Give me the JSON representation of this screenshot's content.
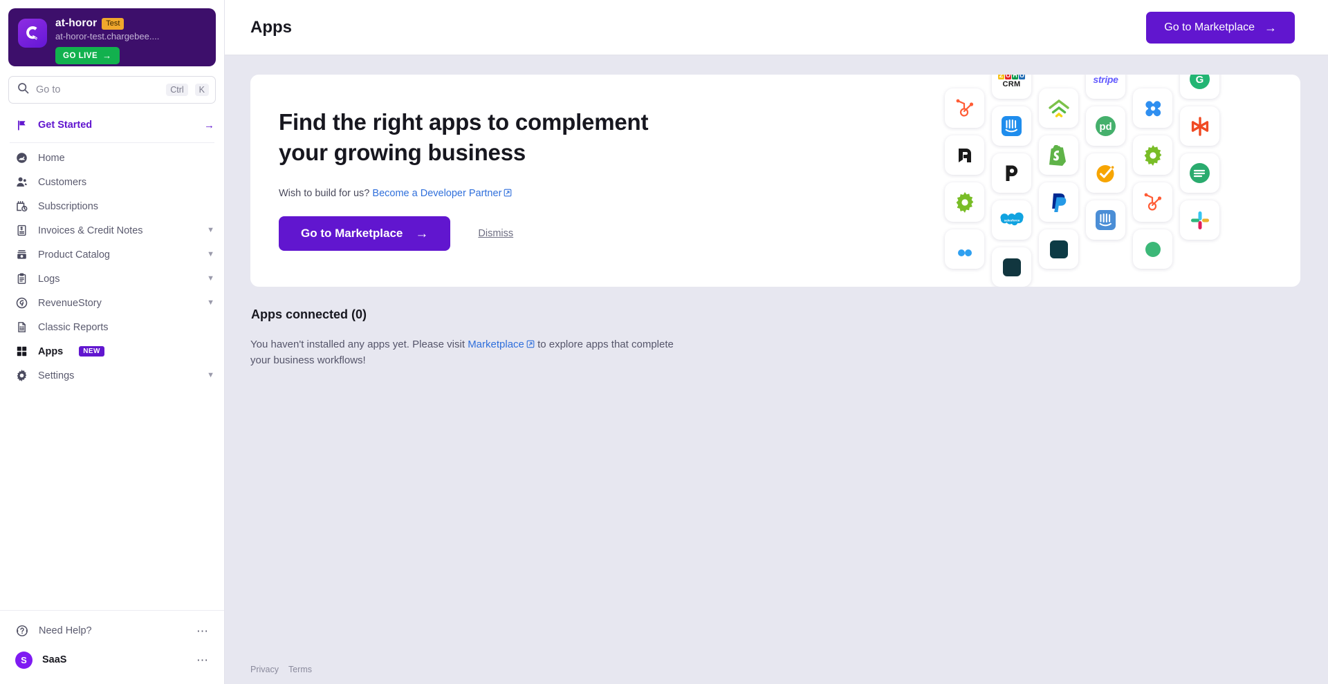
{
  "sidebar": {
    "site": {
      "name": "at-horor",
      "badge": "Test",
      "url": "at-horor-test.chargebee....",
      "go_live_label": "GO LIVE",
      "logo_icon": "chargebee-logo-icon"
    },
    "search": {
      "placeholder": "Go to",
      "shortcut_modifier": "Ctrl",
      "shortcut_key": "K",
      "icon": "search-icon"
    },
    "get_started": {
      "label": "Get Started",
      "icon": "flag-icon",
      "arrow": "→"
    },
    "items": [
      {
        "label": "Home",
        "icon": "dashboard-icon",
        "expandable": false
      },
      {
        "label": "Customers",
        "icon": "customers-icon",
        "expandable": false
      },
      {
        "label": "Subscriptions",
        "icon": "subscriptions-icon",
        "expandable": false
      },
      {
        "label": "Invoices & Credit Notes",
        "icon": "invoice-icon",
        "expandable": true
      },
      {
        "label": "Product Catalog",
        "icon": "product-catalog-icon",
        "expandable": true
      },
      {
        "label": "Logs",
        "icon": "logs-icon",
        "expandable": true
      },
      {
        "label": "RevenueStory",
        "icon": "revenuestory-icon",
        "expandable": true
      },
      {
        "label": "Classic Reports",
        "icon": "reports-icon",
        "expandable": false
      },
      {
        "label": "Apps",
        "icon": "apps-grid-icon",
        "expandable": false,
        "badge": "NEW",
        "active": true
      },
      {
        "label": "Settings",
        "icon": "gear-icon",
        "expandable": true
      }
    ],
    "footer": {
      "help_label": "Need Help?",
      "help_icon": "headset-help-icon",
      "user_label": "SaaS",
      "user_initial": "S",
      "menu_icon": "ellipsis-icon"
    }
  },
  "header": {
    "title": "Apps",
    "marketplace_button": "Go to Marketplace",
    "marketplace_arrow": "→"
  },
  "hero": {
    "heading_line1": "Find the right apps to complement",
    "heading_line2": "your growing business",
    "sub_prefix": "Wish to build for us?",
    "sub_link": "Become a Developer Partner",
    "cta_label": "Go to Marketplace",
    "cta_arrow": "→",
    "dismiss_label": "Dismiss",
    "app_logos": [
      [
        "hubspot-icon",
        "pipefy-icon",
        "gear-green-icon",
        "avalara-blue-icon"
      ],
      [
        "zoho-crm-icon",
        "intercom-icon",
        "pandadoc-p-icon",
        "salesforce-icon",
        "dark-app-icon"
      ],
      [
        "freshdesk-icon",
        "shopify-icon",
        "paypal-icon",
        "navy-app-icon"
      ],
      [
        "stripe-icon",
        "pipedrive-pd-icon",
        "checkmark-orange-icon",
        "intercom-icon"
      ],
      [
        "quadrant-blue-icon",
        "gear-green-icon",
        "hubspot-icon",
        "green-dot-icon"
      ],
      [
        "green-circle-icon",
        "asterisk-red-icon",
        "green-badge-icon",
        "slack-icon"
      ]
    ]
  },
  "connected": {
    "title": "Apps connected (0)",
    "body_prefix": "You haven't installed any apps yet. Please visit",
    "body_link": "Marketplace",
    "body_suffix": "to explore apps that complete your business workflows!"
  },
  "footer": {
    "privacy": "Privacy",
    "terms": "Terms"
  },
  "colors": {
    "accent": "#6116cf",
    "sidebar_card": "#3d0f6b",
    "go_live": "#12b14e",
    "test_badge": "#f0a82c",
    "link": "#2f6fdb",
    "page_bg": "#e7e7f0"
  }
}
